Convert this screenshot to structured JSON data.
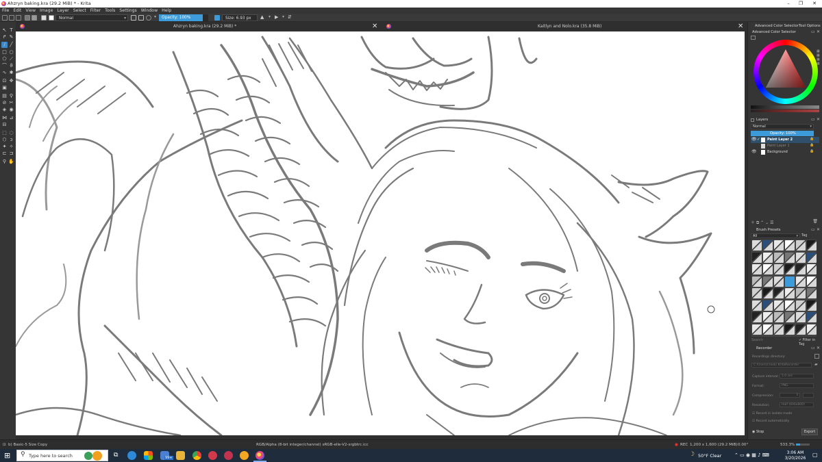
{
  "window": {
    "title": "Ahzryn baking.kra (29.2 MiB) * - Krita",
    "controls": [
      "–",
      "❐",
      "✕"
    ]
  },
  "menu": [
    "File",
    "Edit",
    "View",
    "Image",
    "Layer",
    "Select",
    "Filter",
    "Tools",
    "Settings",
    "Window",
    "Help"
  ],
  "toolbar": {
    "blend_mode": "Normal",
    "opacity_label": "Opacity: 100%",
    "size_label": "Size: 6.93 px"
  },
  "documents": [
    {
      "title": "Ahzryn baking.kra (29.2 MiB) *",
      "close": "✕"
    },
    {
      "title": "Kaitlyn and Nolo.kra (35.8 MiB)",
      "close": "✕"
    }
  ],
  "dock": {
    "tabs": [
      "Advanced Color Selector",
      "Tool Options"
    ],
    "color_selector_title": "Advanced Color Selector",
    "layers_title": "Layers",
    "layers_blend": "Normal",
    "layers_opacity": "Opacity: 100%",
    "layers": [
      {
        "name": "Paint Layer 2",
        "active": true
      },
      {
        "name": "Paint Layer 1",
        "active": false
      },
      {
        "name": "Background",
        "active": false
      }
    ],
    "brush_presets_title": "Brush Presets",
    "brush_filter": "All",
    "brush_tag": "Tag",
    "search_placeholder": "Search",
    "filter_in_tag": "Filter in Tag",
    "recorder_title": "Recorder",
    "recorder": {
      "directory_label": "Recordings directory:",
      "directory_value": "C:/Users/crook/.KritaRecorder",
      "interval_label": "Capture interval:",
      "interval_value": "5.0 sec",
      "format_label": "Format:",
      "format_value": "PNG",
      "compression_label": "Compression:",
      "compression_value": "3",
      "resolution_label": "Resolution:",
      "resolution_value": "Half (600x800)",
      "isolate_label": "Record in isolate mode",
      "auto_label": "Record automatically",
      "stop_label": "Stop",
      "export_label": "Export"
    },
    "colors": {
      "foreground": "#3d9bd9",
      "accent": "#3d88c9"
    }
  },
  "status": {
    "brush": "b) Basic-5 Size Copy",
    "color_space": "RGB/Alpha (8-bit integer/channel)  sRGB-elle-V2-srgbtrc.icc",
    "rec": "REC",
    "dimensions": "1,200 x 1,600 (29.2 MiB)",
    "rotation": "0.00°",
    "zoom": "533.3%"
  },
  "taskbar": {
    "search_placeholder": "Type here to search",
    "weather": "50°F  Clear",
    "time": "3:06 AM",
    "date": "3/20/2026",
    "badge": "99+"
  }
}
